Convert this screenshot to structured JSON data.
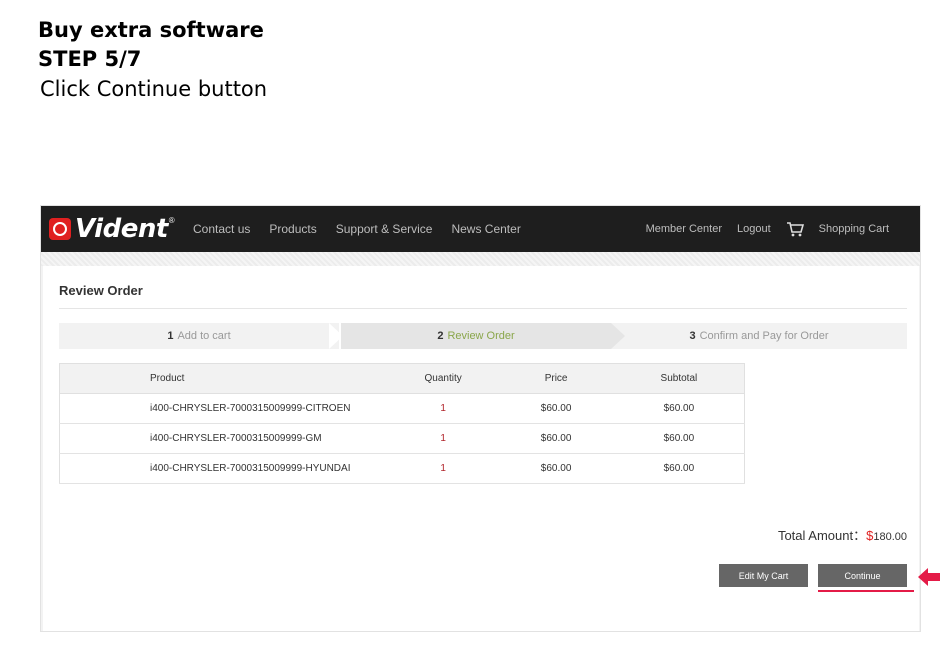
{
  "caption": {
    "line1": "Buy extra software",
    "line2": "STEP 5/7",
    "line3": "Click Continue button"
  },
  "navbar": {
    "logo_text": "Vident",
    "logo_reg": "®",
    "left_links": [
      "Contact us",
      "Products",
      "Support & Service",
      "News Center"
    ],
    "member_center": "Member Center",
    "logout": "Logout",
    "shopping_cart": "Shopping Cart"
  },
  "page": {
    "title": "Review Order",
    "steps": [
      {
        "num": "1",
        "label": "Add to cart"
      },
      {
        "num": "2",
        "label": "Review Order"
      },
      {
        "num": "3",
        "label": "Confirm and Pay for Order"
      }
    ],
    "columns": [
      "Product",
      "Quantity",
      "Price",
      "Subtotal"
    ],
    "rows": [
      {
        "product": "i400-CHRYSLER-7000315009999-CITROEN",
        "qty": "1",
        "price": "$60.00",
        "subtotal": "$60.00"
      },
      {
        "product": "i400-CHRYSLER-7000315009999-GM",
        "qty": "1",
        "price": "$60.00",
        "subtotal": "$60.00"
      },
      {
        "product": "i400-CHRYSLER-7000315009999-HYUNDAI",
        "qty": "1",
        "price": "$60.00",
        "subtotal": "$60.00"
      }
    ],
    "total_label": "Total Amount：",
    "total_currency": "$",
    "total_amount": "180.00",
    "edit_cart_label": "Edit My Cart",
    "continue_label": "Continue"
  },
  "colors": {
    "accent_red": "#e02020",
    "highlight": "#e41b47",
    "active_step": "#8aa64a"
  }
}
